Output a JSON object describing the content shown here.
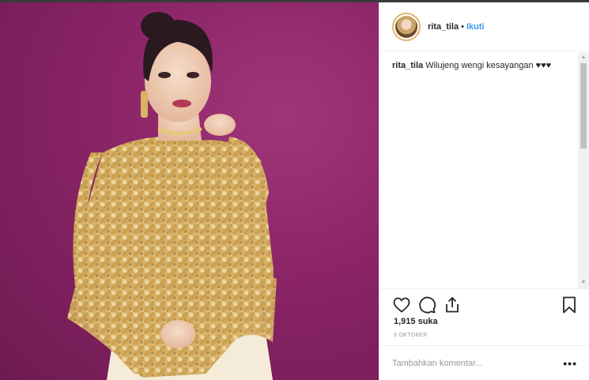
{
  "post": {
    "username": "rita_tila",
    "separator": "•",
    "follow_label": "Ikuti"
  },
  "caption": {
    "username": "rita_tila",
    "text": "Wilujeng wengi kesayangan ♥♥♥"
  },
  "actions": {
    "like_icon": "heart-icon",
    "comment_icon": "comment-icon",
    "share_icon": "share-icon",
    "save_icon": "bookmark-icon"
  },
  "likes": "1,915 suka",
  "date": "8 OKTOBER",
  "add_comment": {
    "placeholder": "Tambahkan komentar...",
    "more_label": "•••"
  },
  "colors": {
    "follow": "#3897f0",
    "background_wall": "#8a2466",
    "dress_gold": "#d9b36a"
  }
}
